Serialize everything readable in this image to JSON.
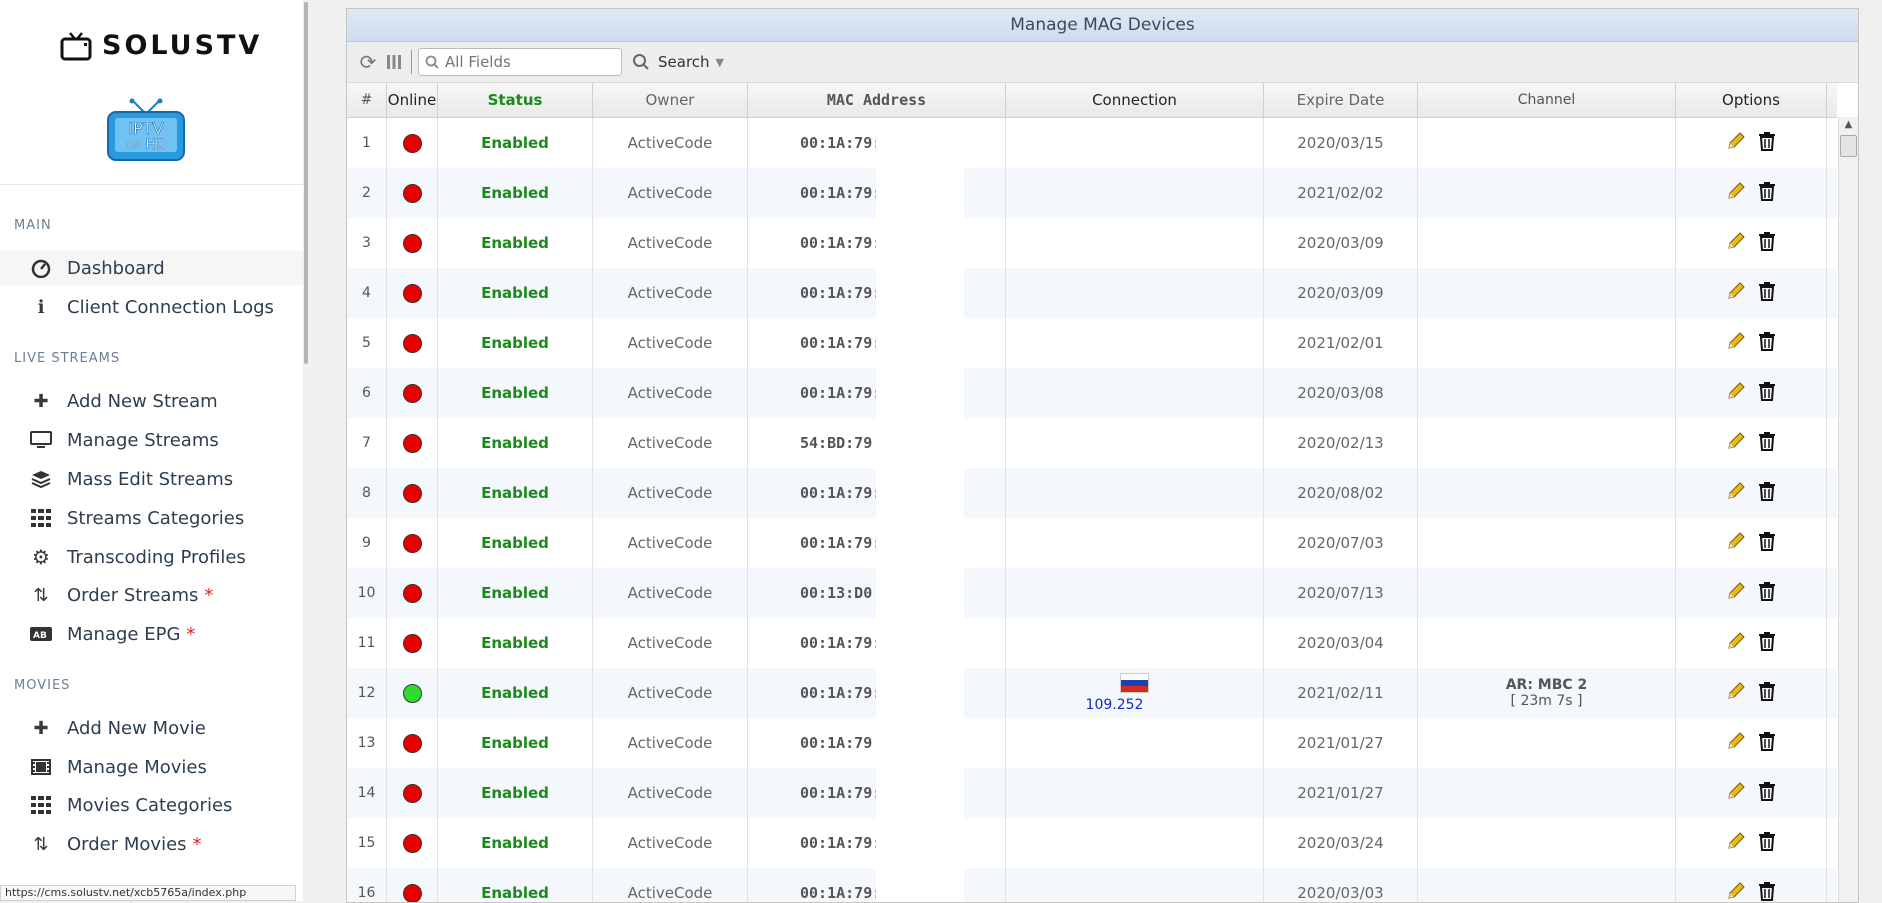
{
  "sidebar": {
    "brand": "SOLUSTV",
    "tv_logo_text": [
      "IPTV",
      "PRO",
      "HD"
    ],
    "sections": [
      {
        "title": "MAIN",
        "items": [
          {
            "label": "Dashboard",
            "icon": "dashboard-icon",
            "glyph": "◔",
            "active": true
          },
          {
            "label": "Client Connection Logs",
            "icon": "info-icon",
            "glyph": "ℹ"
          }
        ]
      },
      {
        "title": "LIVE STREAMS",
        "items": [
          {
            "label": "Add New Stream",
            "icon": "plus-icon",
            "glyph": "✚"
          },
          {
            "label": "Manage Streams",
            "icon": "monitor-icon",
            "glyph": "▭"
          },
          {
            "label": "Mass Edit Streams",
            "icon": "layers-icon",
            "glyph": "≋"
          },
          {
            "label": "Streams Categories",
            "icon": "grid-icon",
            "glyph": "▦"
          },
          {
            "label": "Transcoding Profiles",
            "icon": "cogs-icon",
            "glyph": "⚙"
          },
          {
            "label": "Order Streams",
            "icon": "sort-icon",
            "glyph": "⇅",
            "star": "*"
          },
          {
            "label": "Manage EPG",
            "icon": "epg-icon",
            "glyph": "▤",
            "star": "*"
          }
        ]
      },
      {
        "title": "MOVIES",
        "items": [
          {
            "label": "Add New Movie",
            "icon": "plus-icon",
            "glyph": "✚"
          },
          {
            "label": "Manage Movies",
            "icon": "film-icon",
            "glyph": "▥"
          },
          {
            "label": "Movies Categories",
            "icon": "grid-icon",
            "glyph": "▦"
          },
          {
            "label": "Order Movies",
            "icon": "sort-icon",
            "glyph": "⇅",
            "star": "*"
          }
        ]
      }
    ],
    "status_url": "https://cms.solustv.net/xcb5765a/index.php"
  },
  "panel": {
    "title": "Manage MAG Devices",
    "toolbar": {
      "refresh_icon": "refresh-icon",
      "columns_icon": "columns-icon",
      "search_placeholder": "All Fields",
      "search_label": "Search"
    },
    "columns": [
      "#",
      "Online",
      "Status",
      "Owner",
      "MAC Address",
      "Connection",
      "Expire Date",
      "Channel",
      "Options"
    ],
    "rows": [
      {
        "num": "1",
        "online": "red",
        "status": "Enabled",
        "owner": "ActiveCode",
        "mac": "00:1A:79:",
        "expire": "2020/03/15"
      },
      {
        "num": "2",
        "online": "red",
        "status": "Enabled",
        "owner": "ActiveCode",
        "mac": "00:1A:79:",
        "expire": "2021/02/02"
      },
      {
        "num": "3",
        "online": "red",
        "status": "Enabled",
        "owner": "ActiveCode",
        "mac": "00:1A:79:",
        "expire": "2020/03/09"
      },
      {
        "num": "4",
        "online": "red",
        "status": "Enabled",
        "owner": "ActiveCode",
        "mac": "00:1A:79:",
        "expire": "2020/03/09"
      },
      {
        "num": "5",
        "online": "red",
        "status": "Enabled",
        "owner": "ActiveCode",
        "mac": "00:1A:79:",
        "expire": "2021/02/01"
      },
      {
        "num": "6",
        "online": "red",
        "status": "Enabled",
        "owner": "ActiveCode",
        "mac": "00:1A:79:",
        "expire": "2020/03/08"
      },
      {
        "num": "7",
        "online": "red",
        "status": "Enabled",
        "owner": "ActiveCode",
        "mac": "54:BD:79",
        "expire": "2020/02/13"
      },
      {
        "num": "8",
        "online": "red",
        "status": "Enabled",
        "owner": "ActiveCode",
        "mac": "00:1A:79:",
        "expire": "2020/08/02"
      },
      {
        "num": "9",
        "online": "red",
        "status": "Enabled",
        "owner": "ActiveCode",
        "mac": "00:1A:79:",
        "expire": "2020/07/03"
      },
      {
        "num": "10",
        "online": "red",
        "status": "Enabled",
        "owner": "ActiveCode",
        "mac": "00:13:D0",
        "expire": "2020/07/13"
      },
      {
        "num": "11",
        "online": "red",
        "status": "Enabled",
        "owner": "ActiveCode",
        "mac": "00:1A:79:",
        "expire": "2020/03/04"
      },
      {
        "num": "12",
        "online": "green",
        "status": "Enabled",
        "owner": "ActiveCode",
        "mac": "00:1A:79:",
        "expire": "2021/02/11",
        "ip": "109.252",
        "flag": "russia-flag",
        "channel": "AR: MBC 2",
        "channel_time": "[ 23m 7s ]"
      },
      {
        "num": "13",
        "online": "red",
        "status": "Enabled",
        "owner": "ActiveCode",
        "mac": "00:1A:79",
        "expire": "2021/01/27"
      },
      {
        "num": "14",
        "online": "red",
        "status": "Enabled",
        "owner": "ActiveCode",
        "mac": "00:1A:79:",
        "expire": "2021/01/27"
      },
      {
        "num": "15",
        "online": "red",
        "status": "Enabled",
        "owner": "ActiveCode",
        "mac": "00:1A:79:",
        "expire": "2020/03/24"
      },
      {
        "num": "16",
        "online": "red",
        "status": "Enabled",
        "owner": "ActiveCode",
        "mac": "00:1A:79:",
        "expire": "2020/03/03"
      }
    ]
  },
  "colors": {
    "enabled": "#1b8a1b",
    "offline": "#e60000",
    "online": "#2ddc2d",
    "ip": "#1428c8",
    "edit": "#d9a400"
  }
}
